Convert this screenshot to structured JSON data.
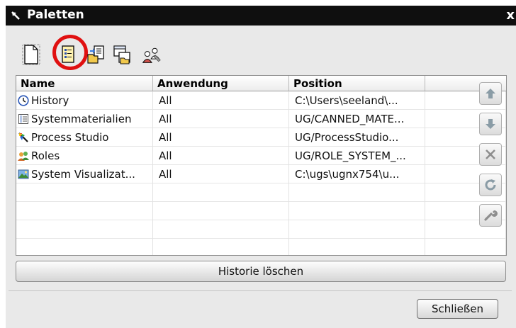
{
  "window": {
    "title": "Paletten",
    "close_glyph": "x"
  },
  "toolbar": {
    "tools": [
      {
        "icon": "new-page-icon",
        "highlighted": false
      },
      {
        "icon": "open-palette-icon",
        "highlighted": true
      },
      {
        "icon": "open-folder-palette-icon",
        "highlighted": false
      },
      {
        "icon": "load-palette-icon",
        "highlighted": false
      },
      {
        "icon": "roles-palette-icon",
        "highlighted": false
      }
    ],
    "highlight_color": "#e01010"
  },
  "table": {
    "columns": [
      "Name",
      "Anwendung",
      "Position",
      ""
    ],
    "rows": [
      {
        "icon": "clock-icon",
        "name": "History",
        "app": "All",
        "position": "C:\\Users\\seeland\\..."
      },
      {
        "icon": "material-list-icon",
        "name": "Systemmaterialien",
        "app": "All",
        "position": "UG/CANNED_MATE..."
      },
      {
        "icon": "process-studio-icon",
        "name": "Process Studio",
        "app": "All",
        "position": "UG/ProcessStudio..."
      },
      {
        "icon": "roles-icon",
        "name": "Roles",
        "app": "All",
        "position": "UG/ROLE_SYSTEM_..."
      },
      {
        "icon": "landscape-icon",
        "name": "System Visualizat...",
        "app": "All",
        "position": "C:\\ugs\\ugnx754\\u..."
      }
    ],
    "empty_rows": 4
  },
  "side_buttons": [
    "move-up-icon",
    "move-down-icon",
    "remove-icon",
    "refresh-icon",
    "wrench-icon"
  ],
  "buttons": {
    "clear_history": "Historie löschen",
    "close": "Schließen"
  }
}
